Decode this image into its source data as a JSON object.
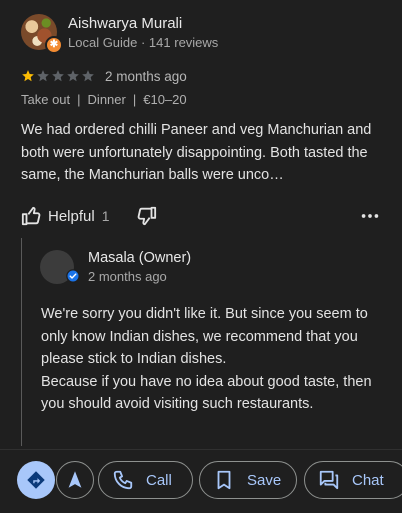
{
  "review": {
    "reviewer_name": "Aishwarya Murali",
    "reviewer_meta": "Local Guide · 141 reviews",
    "rating": 1,
    "rating_max": 5,
    "date": "2 months ago",
    "tags": [
      "Take out",
      "Dinner",
      "€10–20"
    ],
    "text": "We had ordered chilli Paneer and veg Manchurian and both were unfortunately disappointing. Both tasted the same, the Manchurian balls were unco…",
    "helpful_label": "Helpful",
    "helpful_count": "1"
  },
  "owner_reply": {
    "name": "Masala (Owner)",
    "date": "2 months ago",
    "paragraph_1": "We're sorry you didn't like it. But since you seem to only know Indian dishes, we recommend that you please stick to Indian dishes.",
    "paragraph_2": "Because if you have no idea about good taste, then you should avoid visiting such restaurants."
  },
  "bottom_bar": {
    "call_label": "Call",
    "save_label": "Save",
    "chat_label": "Chat"
  },
  "colors": {
    "background": "#1f1f1f",
    "accent": "#a8c7fa",
    "star_filled": "#fbbc04",
    "star_empty": "#5f6368",
    "guide_badge": "#f28b32",
    "verified": "#1a73e8"
  }
}
